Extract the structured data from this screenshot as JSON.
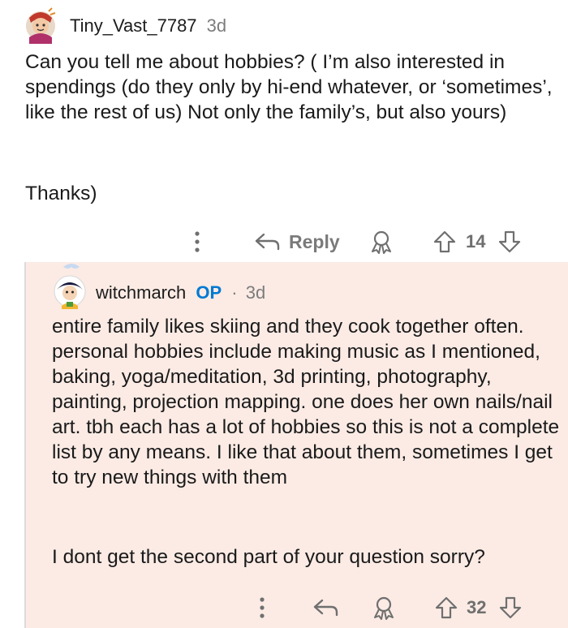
{
  "comment": {
    "author": "Tiny_Vast_7787",
    "time": "3d",
    "body": "Can you tell me about hobbies? ( I’m also interested in spendings (do they only by hi-end whatever, or ‘sometimes’, like the rest of us) Not only the family’s, but also yours)",
    "body_2": "Thanks)",
    "reply_label": "Reply",
    "vote_count": "14"
  },
  "reply": {
    "author": "witchmarch",
    "op_badge": "OP",
    "separator": "·",
    "time": "3d",
    "body": "entire family likes skiing and they cook together often. personal hobbies include making music as I mentioned, baking, yoga/meditation, 3d printing, photography, painting, projection mapping. one does her own nails/nail art. tbh each has a lot of hobbies so this is not a complete list by any means. I like that about them, sometimes I get to try new things with them",
    "body_2": "I dont get the second part of your question sorry?",
    "vote_count": "32"
  },
  "colors": {
    "op_accent": "#0079d3",
    "op_highlight": "#fbebe4",
    "meta_gray": "#7c7c7c"
  },
  "icons": [
    "more-options-icon",
    "reply-arrow-icon",
    "award-icon",
    "upvote-icon",
    "downvote-icon"
  ]
}
